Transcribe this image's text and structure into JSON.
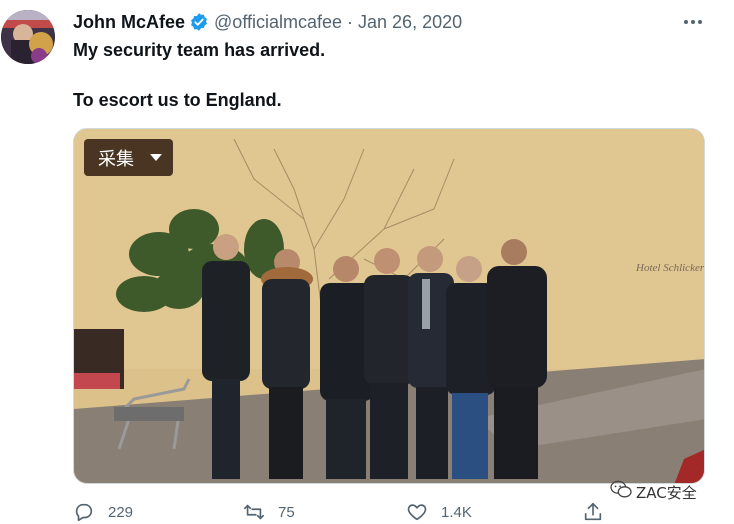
{
  "tweet": {
    "author_name": "John McAfee",
    "handle_date": "@officialmcafee · Jan 26, 2020",
    "line1": "My security team has arrived.",
    "line2": "To escort us to England.",
    "verified": true,
    "accent_color": "#1d9bf0"
  },
  "media": {
    "collect_label": "采集",
    "sign_text": "Hotel Schlicker"
  },
  "actions": {
    "replies": "229",
    "retweets": "75",
    "likes": "1.4K"
  },
  "watermark": {
    "text": "ZAC安全"
  }
}
